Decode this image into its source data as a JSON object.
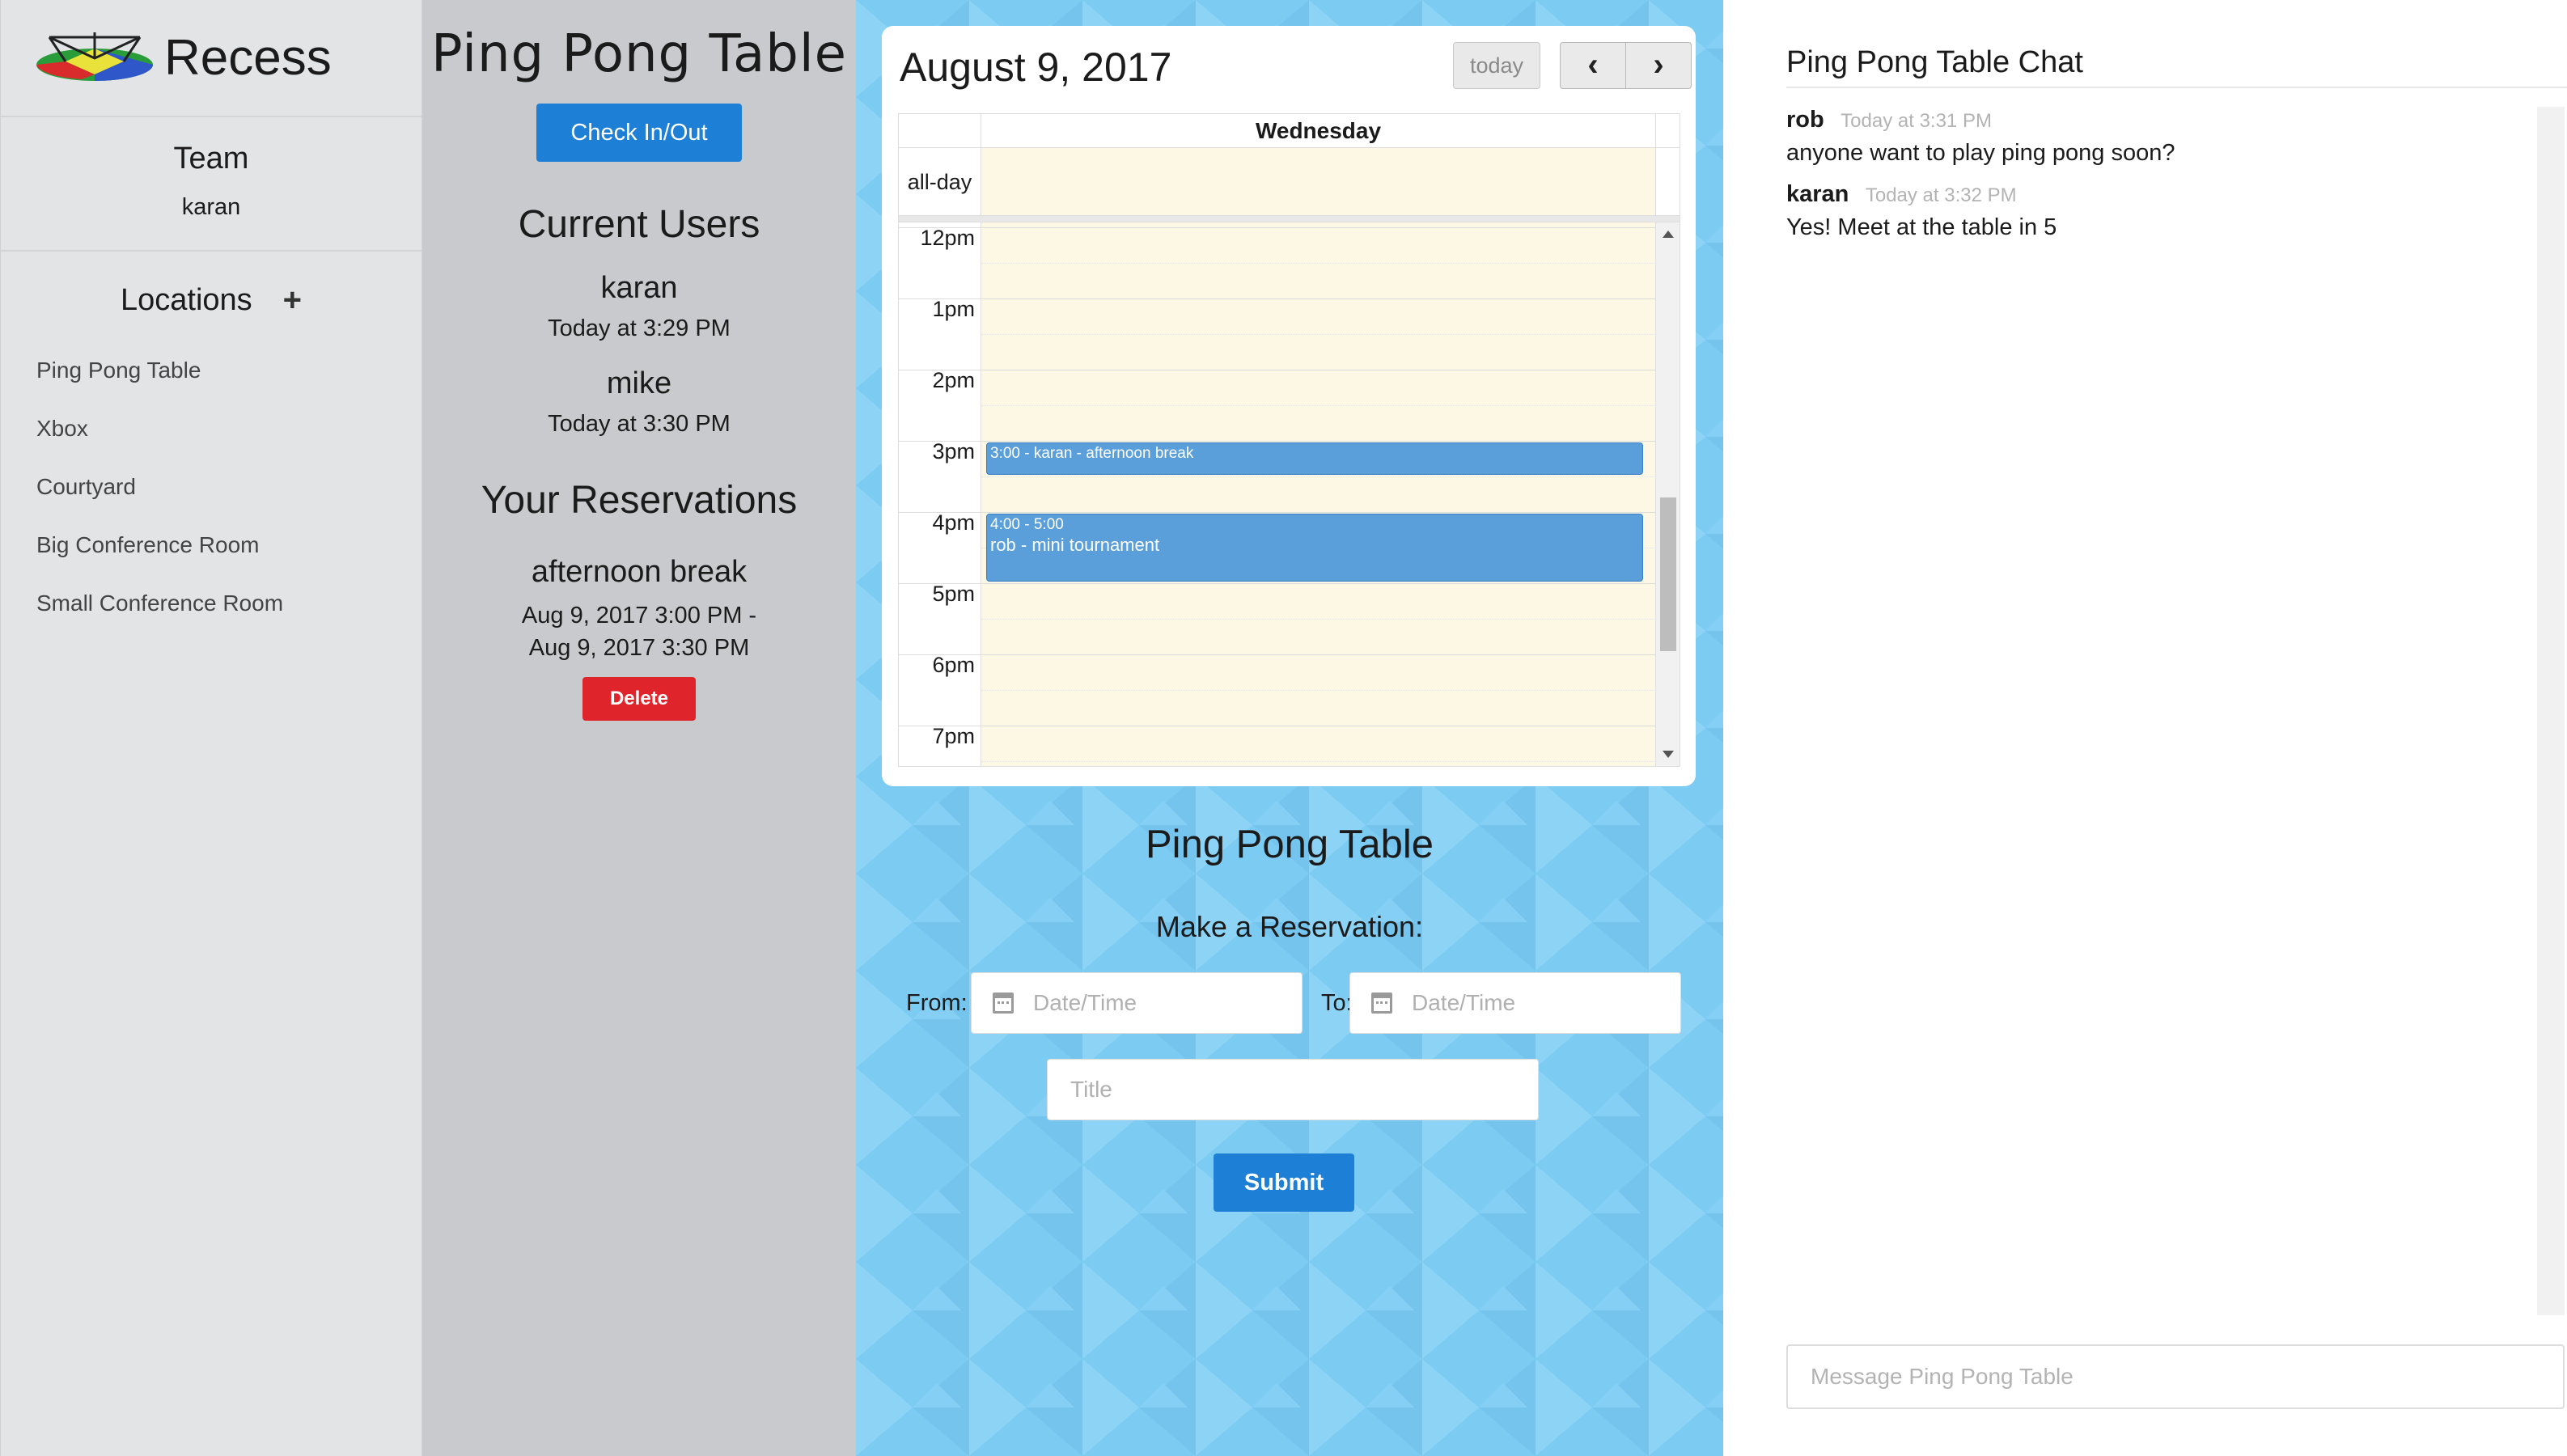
{
  "brand": {
    "name": "Recess"
  },
  "team": {
    "title": "Team",
    "user": "karan"
  },
  "locations": {
    "title": "Locations",
    "add_icon": "plus-icon",
    "items": [
      "Ping Pong Table",
      "Xbox",
      "Courtyard",
      "Big Conference Room",
      "Small Conference Room"
    ]
  },
  "info": {
    "title": "Ping Pong Table",
    "checkin_label": "Check In/Out",
    "current_users_title": "Current Users",
    "users": [
      {
        "name": "karan",
        "time": "Today at 3:29 PM"
      },
      {
        "name": "mike",
        "time": "Today at 3:30 PM"
      }
    ],
    "reservations_title": "Your Reservations",
    "reservation": {
      "title": "afternoon break",
      "range_line1": "Aug 9, 2017 3:00 PM -",
      "range_line2": "Aug 9, 2017 3:30 PM",
      "delete_label": "Delete"
    }
  },
  "calendar": {
    "date": "August 9, 2017",
    "today_label": "today",
    "prev_icon": "chevron-left-icon",
    "next_icon": "chevron-right-icon",
    "prev_glyph": "‹",
    "next_glyph": "›",
    "day_name": "Wednesday",
    "allday_label": "all-day",
    "hours": [
      "12pm",
      "1pm",
      "2pm",
      "3pm",
      "4pm",
      "5pm",
      "6pm",
      "7pm"
    ],
    "events": [
      {
        "time": "3:00 - karan - afternoon break",
        "start": 15,
        "end": 15.5
      },
      {
        "time": "4:00 - 5:00",
        "name": "rob - mini tournament",
        "start": 16,
        "end": 17
      }
    ],
    "event_color": "#5a9fd9"
  },
  "reserve": {
    "location_title": "Ping Pong Table",
    "subtitle": "Make a Reservation:",
    "from_label": "From:",
    "to_label": "To:",
    "from_placeholder": "Date/Time",
    "to_placeholder": "Date/Time",
    "title_placeholder": "Title",
    "submit_label": "Submit"
  },
  "chat": {
    "title": "Ping Pong Table Chat",
    "messages": [
      {
        "user": "rob",
        "time": "Today at 3:31 PM",
        "text": "anyone want to play ping pong soon?"
      },
      {
        "user": "karan",
        "time": "Today at 3:32 PM",
        "text": "Yes! Meet at the table in 5"
      }
    ],
    "input_placeholder": "Message Ping Pong Table"
  },
  "colors": {
    "primary": "#1d7fd6",
    "danger": "#e0242b",
    "center_bg": "#7ccbf2",
    "sidebar_bg": "#e3e4e6",
    "info_bg": "#c9cacd"
  }
}
